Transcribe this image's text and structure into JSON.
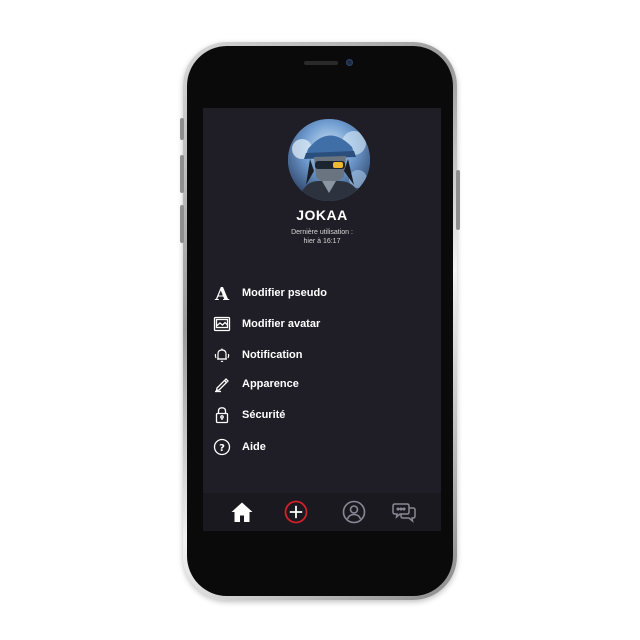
{
  "profile": {
    "username": "JOKAA",
    "last_used_label": "Dernière utilisation :",
    "last_used_value": "hier à 16:17",
    "avatar_icon": "avatar"
  },
  "menu": [
    {
      "label": "Modifier pseudo",
      "icon": "letter-a-icon"
    },
    {
      "label": "Modifier avatar",
      "icon": "image-icon"
    },
    {
      "label": "Notification",
      "icon": "bell-icon"
    },
    {
      "label": "Apparence",
      "icon": "pen-icon"
    },
    {
      "label": "Sécurité",
      "icon": "lock-icon"
    },
    {
      "label": "Aide",
      "icon": "help-icon"
    }
  ],
  "bottom_nav": [
    {
      "icon": "home-icon",
      "active": true
    },
    {
      "icon": "add-icon",
      "active": false
    },
    {
      "icon": "profile-icon",
      "active": false
    },
    {
      "icon": "chat-icon",
      "active": false
    }
  ],
  "colors": {
    "screen_bg": "#1f1e26",
    "nav_bg": "#1a1920",
    "accent_red": "#d0202a",
    "text": "#ffffff",
    "muted_icon": "#8a8894"
  }
}
